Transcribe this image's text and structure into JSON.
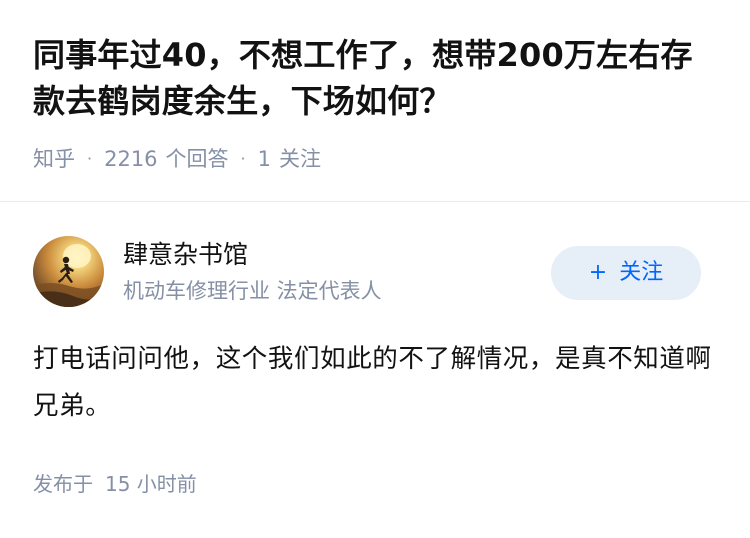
{
  "question": {
    "title": "同事年过40，不想工作了，想带200万左右存款去鹤岗度余生，下场如何？",
    "source": "知乎",
    "separator": "·",
    "answer_count": "2216",
    "answer_count_label": "个回答",
    "follower_count": "1",
    "follower_count_label": "关注"
  },
  "author": {
    "name": "肆意杂书馆",
    "headline": "机动车修理行业 法定代表人",
    "avatar_icon": "runner-sunset-avatar",
    "follow_plus": "+",
    "follow_label": "关注"
  },
  "answer": {
    "content": "打电话问问他，这个我们如此的不了解情况，是真不知道啊兄弟。",
    "time_label": "发布于",
    "time_value": "15 小时前"
  },
  "colors": {
    "text_primary": "#121212",
    "text_secondary": "#8590a6",
    "accent": "#0066ff",
    "follow_bg": "#e6eef8",
    "divider": "#ebebeb"
  }
}
